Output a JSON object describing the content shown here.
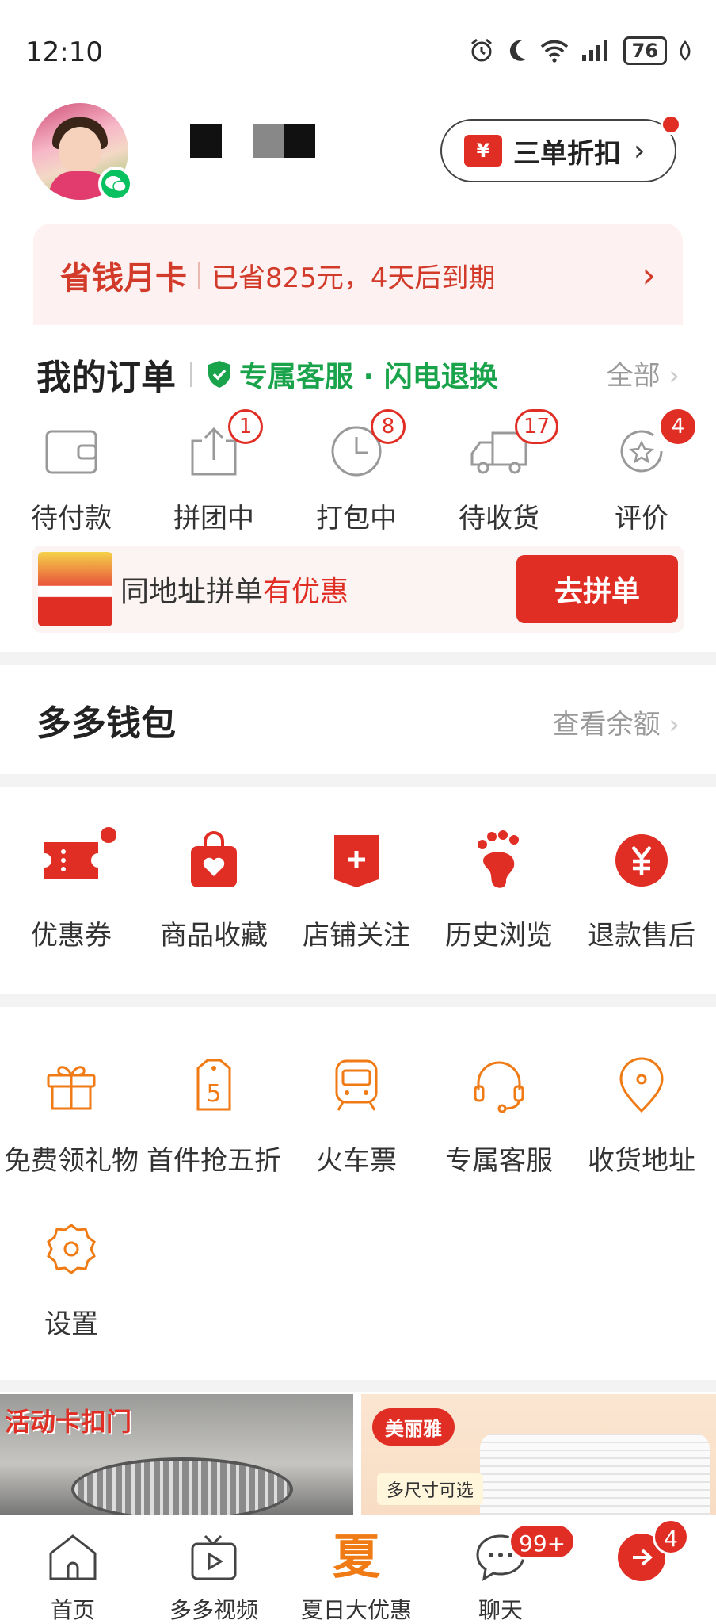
{
  "status_bar": {
    "time": "12:10",
    "battery": "76"
  },
  "header": {
    "discount_label": "三单折扣",
    "discount_icon": "¥"
  },
  "savings_card": {
    "title": "省钱月卡",
    "detail": "已省825元，4天后到期"
  },
  "orders": {
    "title": "我的订单",
    "service": "专属客服 · 闪电退换",
    "view_all": "全部",
    "items": [
      {
        "label": "待付款",
        "badge": null
      },
      {
        "label": "拼团中",
        "badge": "1"
      },
      {
        "label": "打包中",
        "badge": "8"
      },
      {
        "label": "待收货",
        "badge": "17"
      },
      {
        "label": "评价",
        "badge": "4"
      }
    ],
    "group_bar": {
      "text_plain": "同地址拼单",
      "text_highlight": "有优惠",
      "button": "去拼单"
    }
  },
  "wallet": {
    "title": "多多钱包",
    "action": "查看余额"
  },
  "services_primary": [
    {
      "label": "优惠券",
      "icon": "coupon-icon"
    },
    {
      "label": "商品收藏",
      "icon": "bag-heart-icon"
    },
    {
      "label": "店铺关注",
      "icon": "store-plus-icon"
    },
    {
      "label": "历史浏览",
      "icon": "footprint-icon"
    },
    {
      "label": "退款售后",
      "icon": "yuan-icon"
    }
  ],
  "services_secondary": [
    {
      "label": "免费领礼物",
      "icon": "gift-icon"
    },
    {
      "label": "首件抢五折",
      "icon": "tag-5-icon"
    },
    {
      "label": "火车票",
      "icon": "train-icon"
    },
    {
      "label": "专属客服",
      "icon": "headset-icon"
    },
    {
      "label": "收货地址",
      "icon": "location-icon"
    },
    {
      "label": "设置",
      "icon": "settings-icon"
    }
  ],
  "banners": {
    "left_caption": "活动卡扣门",
    "right_brand": "美丽雅",
    "right_tag": "多尺寸可选"
  },
  "tabbar": {
    "items": [
      {
        "label": "首页",
        "icon": "home-icon"
      },
      {
        "label": "多多视频",
        "icon": "video-icon"
      },
      {
        "label": "夏日大优惠",
        "icon_text": "夏"
      },
      {
        "label": "聊天",
        "icon": "chat-icon",
        "badge": "99+"
      },
      {
        "label": "",
        "icon": "profile-icon",
        "badge": "4"
      }
    ]
  },
  "colors": {
    "accent": "#e02e24",
    "service_green": "#19a34a",
    "icon_orange": "#f07a14"
  }
}
